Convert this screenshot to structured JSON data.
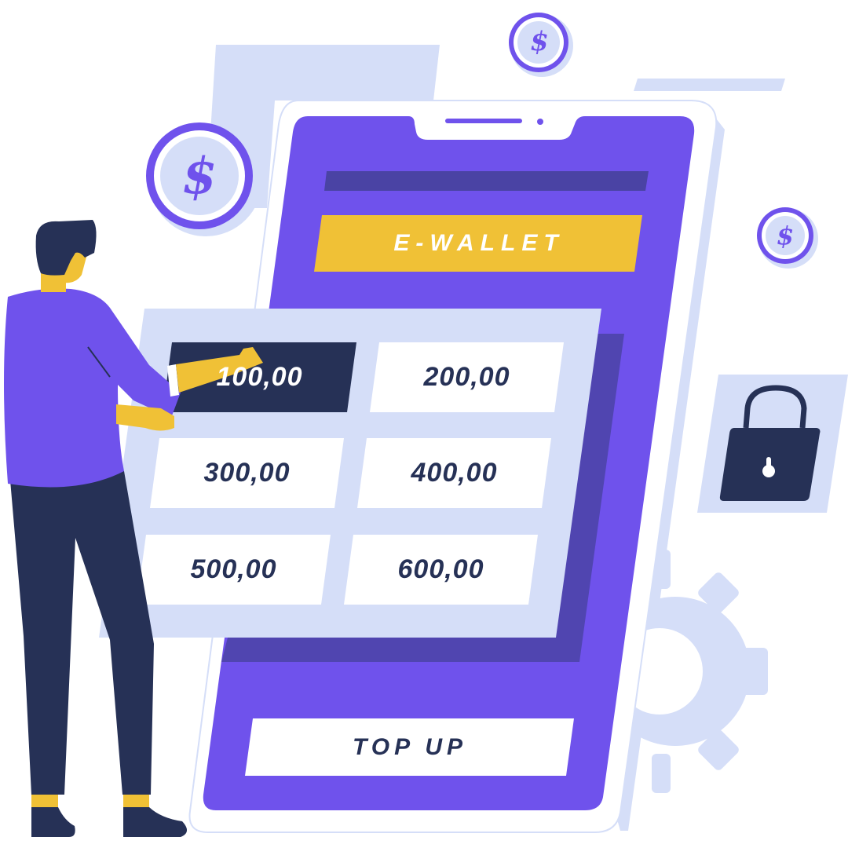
{
  "wallet": {
    "banner_label": "E-WALLET",
    "amounts": [
      {
        "label": "100,00",
        "selected": true
      },
      {
        "label": "200,00",
        "selected": false
      },
      {
        "label": "300,00",
        "selected": false
      },
      {
        "label": "400,00",
        "selected": false
      },
      {
        "label": "500,00",
        "selected": false
      },
      {
        "label": "600,00",
        "selected": false
      }
    ],
    "top_up_label": "TOP UP"
  },
  "coins": [
    {
      "symbol": "$"
    },
    {
      "symbol": "$"
    },
    {
      "symbol": "$"
    }
  ],
  "icons": [
    "dollar-coin-icon",
    "padlock-icon",
    "gear-icon",
    "person-figure"
  ],
  "colors": {
    "phone_purple": "#6F52EC",
    "dark_purple": "#5045B0",
    "light_lavender": "#D5DEF8",
    "banner_yellow": "#F0C136",
    "navy": "#263156",
    "skin": "#F0C136",
    "white": "#FFFFFF"
  }
}
